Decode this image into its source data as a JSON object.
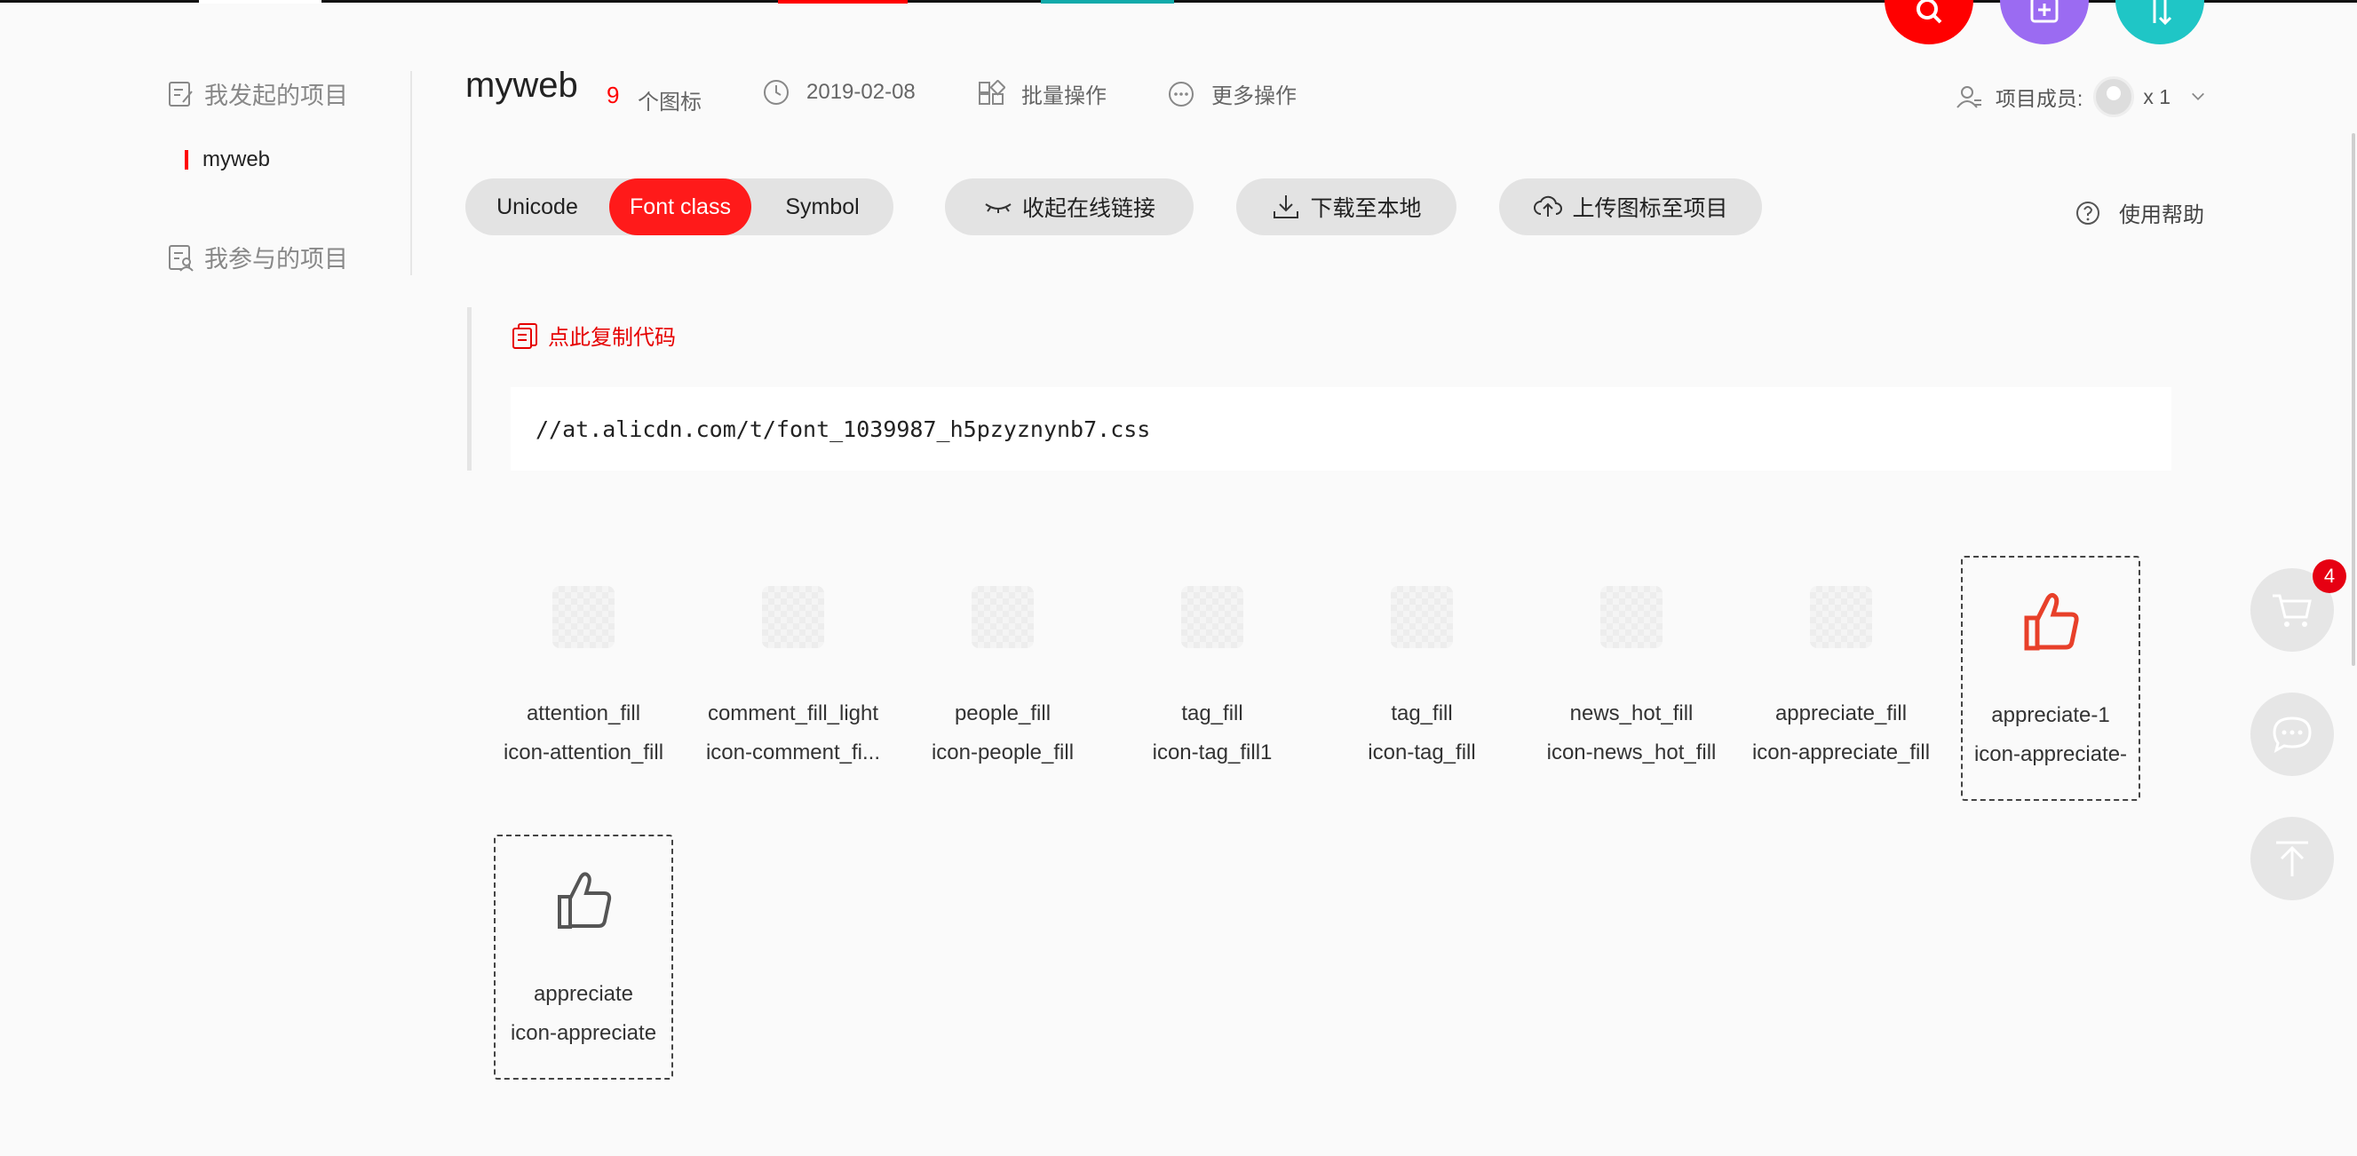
{
  "colors": {
    "accent": "#ff1a1a",
    "fab_search": "#ff0000",
    "fab_add": "#9b6bf2",
    "fab_sort": "#1fc6c6"
  },
  "sidebar": {
    "my_projects": "我发起的项目",
    "my_projects_icon": "edit-doc-icon",
    "project_item": "myweb",
    "joined_projects": "我参与的项目",
    "joined_projects_icon": "user-doc-icon"
  },
  "header": {
    "title": "myweb",
    "icon_count": "9",
    "icon_count_label": "个图标",
    "date": "2019-02-08",
    "batch": "批量操作",
    "more": "更多操作",
    "members_label": "项目成员:",
    "members_count": "x 1"
  },
  "toolbar": {
    "tabs": [
      {
        "label": "Unicode"
      },
      {
        "label": "Font class"
      },
      {
        "label": "Symbol"
      }
    ],
    "active_tab": "Font class",
    "collapse_link": "收起在线链接",
    "download": "下载至本地",
    "upload": "上传图标至项目",
    "help": "使用帮助"
  },
  "code": {
    "copy_label": "点此复制代码",
    "url": "//at.alicdn.com/t/font_1039987_h5pzyznynb7.css"
  },
  "icons": [
    {
      "name": "attention_fill",
      "code": "icon-attention_fill"
    },
    {
      "name": "comment_fill_light",
      "code": "icon-comment_fi..."
    },
    {
      "name": "people_fill",
      "code": "icon-people_fill"
    },
    {
      "name": "tag_fill",
      "code": "icon-tag_fill1"
    },
    {
      "name": "tag_fill",
      "code": "icon-tag_fill"
    },
    {
      "name": "news_hot_fill",
      "code": "icon-news_hot_fill"
    },
    {
      "name": "appreciate_fill",
      "code": "icon-appreciate_fill"
    },
    {
      "name": "appreciate-1",
      "code": "icon-appreciate-"
    },
    {
      "name": "appreciate",
      "code": "icon-appreciate"
    }
  ],
  "floats": {
    "cart_badge": "4"
  }
}
